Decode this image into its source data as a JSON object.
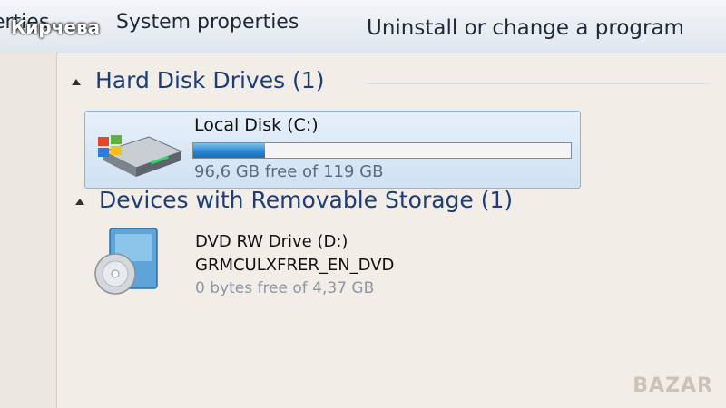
{
  "toolbar": {
    "partial_label": "perties",
    "system_properties_label": "System properties",
    "uninstall_label": "Uninstall or change a program"
  },
  "watermark": {
    "name": "Кирчева",
    "brand": "BAZAR"
  },
  "groups": {
    "hard_disk_drives": {
      "title": "Hard Disk Drives (1)",
      "drive": {
        "name": "Local Disk (C:)",
        "free_text": "96,6 GB free of 119 GB",
        "used_fraction": 0.19,
        "bar_color": "#2a86d3",
        "icon": "hard-disk-windows-icon"
      }
    },
    "removable_storage": {
      "title": "Devices with Removable Storage (1)",
      "drive": {
        "name": "DVD RW Drive (D:)",
        "label": "GRMCULXFRER_EN_DVD",
        "free_text": "0 bytes free of 4,37 GB",
        "icon": "dvd-disc-icon"
      }
    }
  },
  "colors": {
    "accent": "#1c3d78",
    "selection": "#cfe1f3"
  }
}
